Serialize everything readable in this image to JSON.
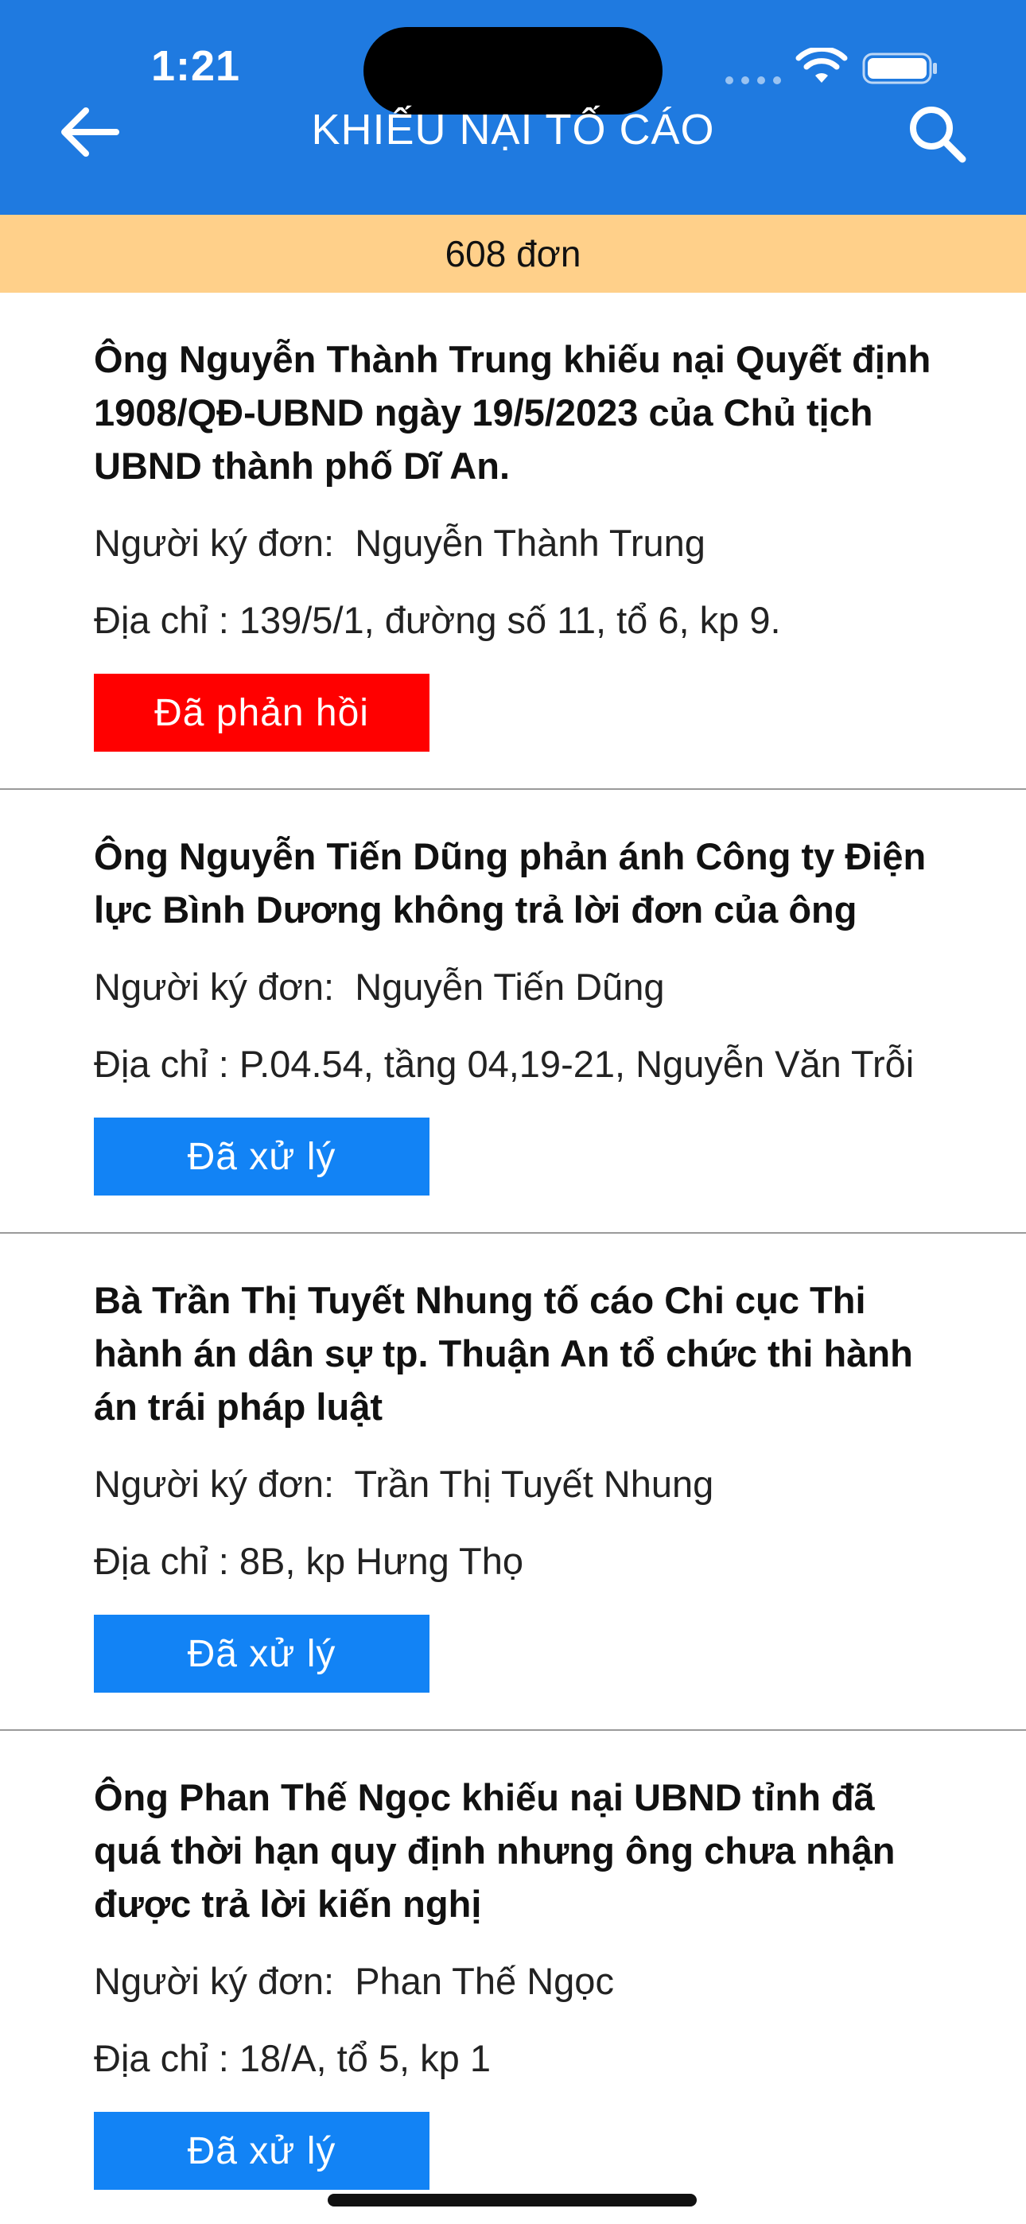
{
  "status_bar": {
    "time": "1:21"
  },
  "header": {
    "title": "KHIẾU NẠI TỐ CÁO"
  },
  "count_bar": {
    "text": "608 đơn"
  },
  "colors": {
    "header_bg": "#1f7ae0",
    "count_bg": "#ffd08a",
    "status_red": "#ff0000",
    "status_blue": "#1283f5"
  },
  "icons": {
    "back": "arrow-left-icon",
    "search": "search-icon",
    "wifi": "wifi-icon",
    "battery": "battery-icon"
  },
  "items": [
    {
      "title": "Ông Nguyễn Thành Trung khiếu nại Quyết định 1908/QĐ-UBND ngày 19/5/2023 của Chủ tịch UBND thành phố Dĩ An.",
      "signer": "Người ký đơn:  Nguyễn Thành Trung",
      "address": "Địa chỉ : 139/5/1, đường số 11, tổ 6, kp 9.",
      "status": "Đã phản hồi",
      "status_color": "red"
    },
    {
      "title": "Ông Nguyễn Tiến Dũng phản ánh Công ty Điện lực Bình Dương không trả lời đơn của ông",
      "signer": "Người ký đơn:  Nguyễn Tiến Dũng",
      "address": "Địa chỉ : P.04.54, tầng 04,19-21, Nguyễn Văn Trỗi",
      "status": "Đã xử  lý",
      "status_color": "blue"
    },
    {
      "title": "Bà Trần Thị Tuyết Nhung tố cáo Chi cục Thi hành án dân sự tp. Thuận An tổ chức thi hành án trái pháp luật",
      "signer": "Người ký đơn:  Trần Thị Tuyết Nhung",
      "address": "Địa chỉ : 8B, kp Hưng Thọ",
      "status": "Đã xử  lý",
      "status_color": "blue"
    },
    {
      "title": "Ông Phan Thế Ngọc khiếu nại UBND tỉnh đã quá thời hạn quy định nhưng ông chưa nhận được trả lời kiến nghị",
      "signer": "Người ký đơn:  Phan Thế Ngọc",
      "address": "Địa chỉ : 18/A, tổ 5, kp 1",
      "status": "Đã xử  lý",
      "status_color": "blue"
    }
  ]
}
